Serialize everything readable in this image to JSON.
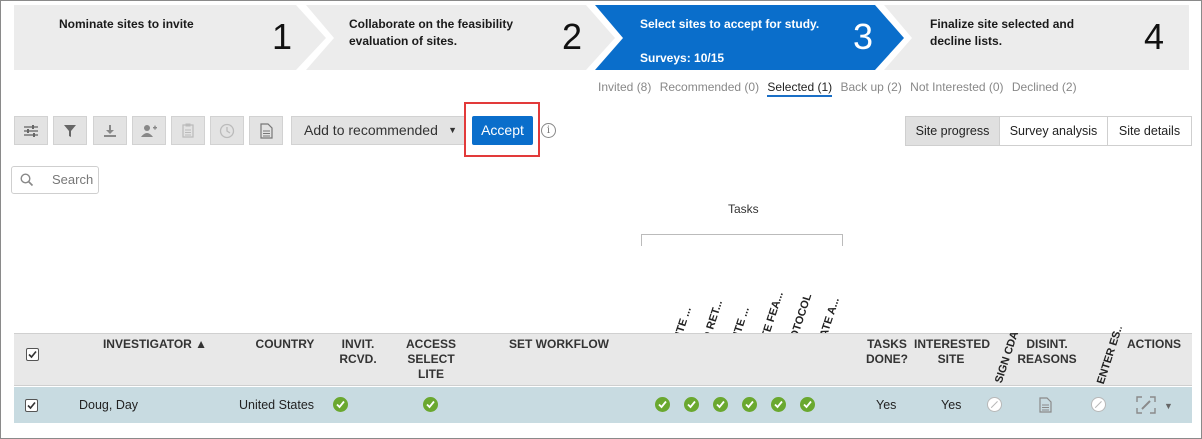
{
  "wizard": {
    "steps": [
      {
        "title": "Nominate sites to invite",
        "number": "1",
        "subtitle": ""
      },
      {
        "title": "Collaborate on the feasibility evaluation of sites.",
        "number": "2",
        "subtitle": ""
      },
      {
        "title": "Select sites to accept for study.",
        "number": "3",
        "subtitle": "Surveys: 10/15"
      },
      {
        "title": "Finalize site selected and decline lists.",
        "number": "4",
        "subtitle": ""
      }
    ],
    "active_color": "#0a6ecb",
    "inactive_color": "#ececec"
  },
  "filters": {
    "items": [
      "Invited (8)",
      "Recommended (0)",
      "Selected (1)",
      "Back up (2)",
      "Not Interested (0)",
      "Declined (2)"
    ],
    "selected": "Selected (1)"
  },
  "toolbar": {
    "icons": [
      "columns-settings-icon",
      "filter-icon",
      "download-icon",
      "add-user-icon",
      "clipboard-icon",
      "clock-icon",
      "document-icon"
    ],
    "dropdown_value": "Add to recommended",
    "accept_label": "Accept",
    "info_glyph": "i",
    "views": [
      "Site progress",
      "Survey analysis",
      "Site details"
    ],
    "selected_view": "Site progress"
  },
  "search": {
    "placeholder": "Search"
  },
  "tasks_group_label": "Tasks",
  "table": {
    "columns": {
      "investigator": "INVESTIGATOR ▲",
      "country": "COUNTRY",
      "invit": "INVIT. RCVD.",
      "access": "ACCESS SELECT LITE",
      "workflow": "SET WORKFLOW",
      "tasks_done": "TASKS DONE?",
      "interested": "INTERESTED SITE",
      "disint": "DISINT. REASONS",
      "actions": "ACTIONS"
    },
    "rotated_columns": [
      "VERIFY SITE ...",
      "SIGN AND RET...",
      "VERIFY SITE ...",
      "COMPLETE FEA...",
      "VIEW PROTOCOL",
      "ENTER DATE A...",
      "SIGN CDA",
      "ENTER ES..."
    ],
    "rows": [
      {
        "investigator": "Doug, Day",
        "country": "United States",
        "tasks_done": "Yes",
        "interested": "Yes",
        "checked": true
      }
    ],
    "row_color": "#c8dbe1",
    "ok_color": "#6aa82f"
  }
}
